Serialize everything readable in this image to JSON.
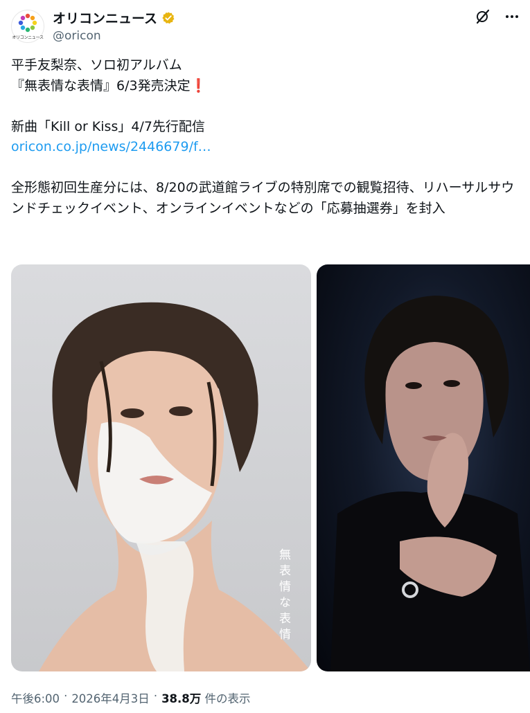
{
  "account": {
    "display_name": "オリコンニュース",
    "handle": "@oricon",
    "avatar_caption": "オリコンニュース",
    "verified_color": "#e8b511"
  },
  "tweet": {
    "line1": "平手友梨奈、ソロ初アルバム",
    "line2": "『無表情な表情』6/3発売決定",
    "line2_mark": "❗",
    "line3": "新曲「Kill or Kiss」4/7先行配信",
    "link": "oricon.co.jp/news/2446679/f…",
    "paragraph": "全形態初回生産分には、8/20の武道館ライブの特別席での観覧招待、リハーサルサウンドチェックイベント、オンラインイベントなどの「応募抽選券」を封入"
  },
  "media": {
    "album_title_art": "無表情な表情"
  },
  "meta": {
    "time": "午後6:00",
    "date": "2026年4月3日",
    "sep": "·",
    "views": "38.8万",
    "views_suffix": "件の表示"
  },
  "colors": {
    "link": "#1d9bf0",
    "secondary_text": "#536471",
    "exclaim": "#dd2e44"
  }
}
